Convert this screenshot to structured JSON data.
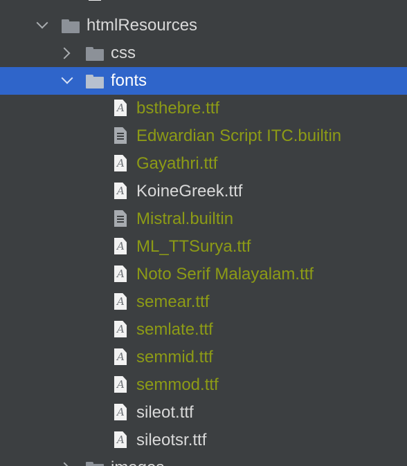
{
  "tree": {
    "folders": {
      "htmlResources": "htmlResources",
      "css": "css",
      "fonts": "fonts",
      "images": "images"
    },
    "files": [
      {
        "name": "bsthebre.ttf",
        "kind": "font",
        "status": "modified"
      },
      {
        "name": "Edwardian Script ITC.builtin",
        "kind": "builtin",
        "status": "modified"
      },
      {
        "name": "Gayathri.ttf",
        "kind": "font",
        "status": "modified"
      },
      {
        "name": "KoineGreek.ttf",
        "kind": "font",
        "status": "normal"
      },
      {
        "name": "Mistral.builtin",
        "kind": "builtin",
        "status": "modified"
      },
      {
        "name": "ML_TTSurya.ttf",
        "kind": "font",
        "status": "modified"
      },
      {
        "name": "Noto Serif Malayalam.ttf",
        "kind": "font",
        "status": "modified"
      },
      {
        "name": "semear.ttf",
        "kind": "font",
        "status": "modified"
      },
      {
        "name": "semlate.ttf",
        "kind": "font",
        "status": "modified"
      },
      {
        "name": "semmid.ttf",
        "kind": "font",
        "status": "modified"
      },
      {
        "name": "semmod.ttf",
        "kind": "font",
        "status": "modified"
      },
      {
        "name": "sileot.ttf",
        "kind": "font",
        "status": "normal"
      },
      {
        "name": "sileotsr.ttf",
        "kind": "font",
        "status": "normal"
      }
    ],
    "font_glyph": "A",
    "selected": "fonts"
  },
  "colors": {
    "background": "#3c3f41",
    "selection": "#2f65ca",
    "modified_text": "#8d9b16",
    "normal_text": "#d9d9d9"
  },
  "icons": {
    "expanded": "chevron-down-icon",
    "collapsed": "chevron-right-icon",
    "folder": "folder-icon",
    "font_file": "font-file-icon",
    "builtin_file": "text-file-icon"
  }
}
